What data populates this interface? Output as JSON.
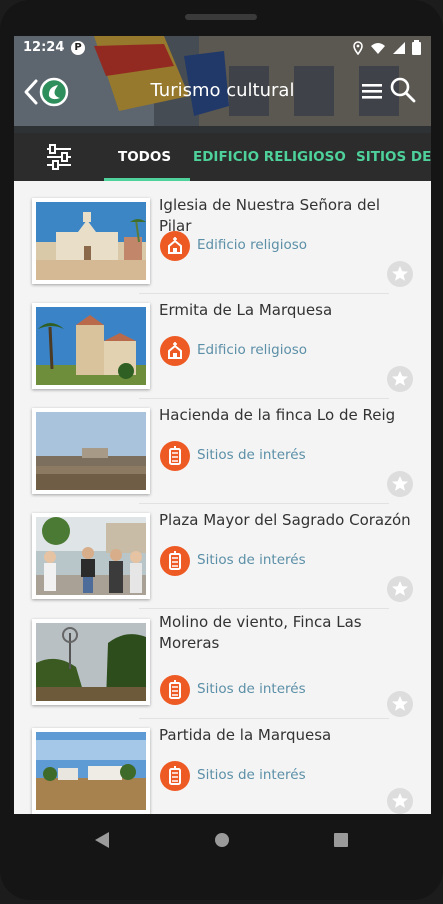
{
  "status_bar": {
    "time": "12:24",
    "indicator_letter": "P"
  },
  "header": {
    "title": "Turismo cultural"
  },
  "tabs": [
    {
      "label": "TODOS",
      "active": true
    },
    {
      "label": "EDIFICIO RELIGIOSO",
      "active": false
    },
    {
      "label": "SITIOS DE I",
      "active": false
    }
  ],
  "items": [
    {
      "title": "Iglesia de Nuestra Señora del Pilar",
      "category": "Edificio religioso",
      "category_icon": "church-icon"
    },
    {
      "title": "Ermita de La Marquesa",
      "category": "Edificio religioso",
      "category_icon": "church-icon"
    },
    {
      "title": "Hacienda de la finca Lo de Reig",
      "category": "Sitios de interés",
      "category_icon": "landmark-icon"
    },
    {
      "title": "Plaza Mayor del Sagrado Corazón",
      "category": "Sitios de interés",
      "category_icon": "landmark-icon"
    },
    {
      "title": "Molino de viento, Finca Las Moreras",
      "category": "Sitios de interés",
      "category_icon": "landmark-icon"
    },
    {
      "title": "Partida de la Marquesa",
      "category": "Sitios de interés",
      "category_icon": "landmark-icon"
    }
  ],
  "colors": {
    "accent": "#4ed19b",
    "category_circle": "#ee5a24",
    "category_text": "#5b8fa7",
    "tab_bar": "#2c2c2c"
  }
}
